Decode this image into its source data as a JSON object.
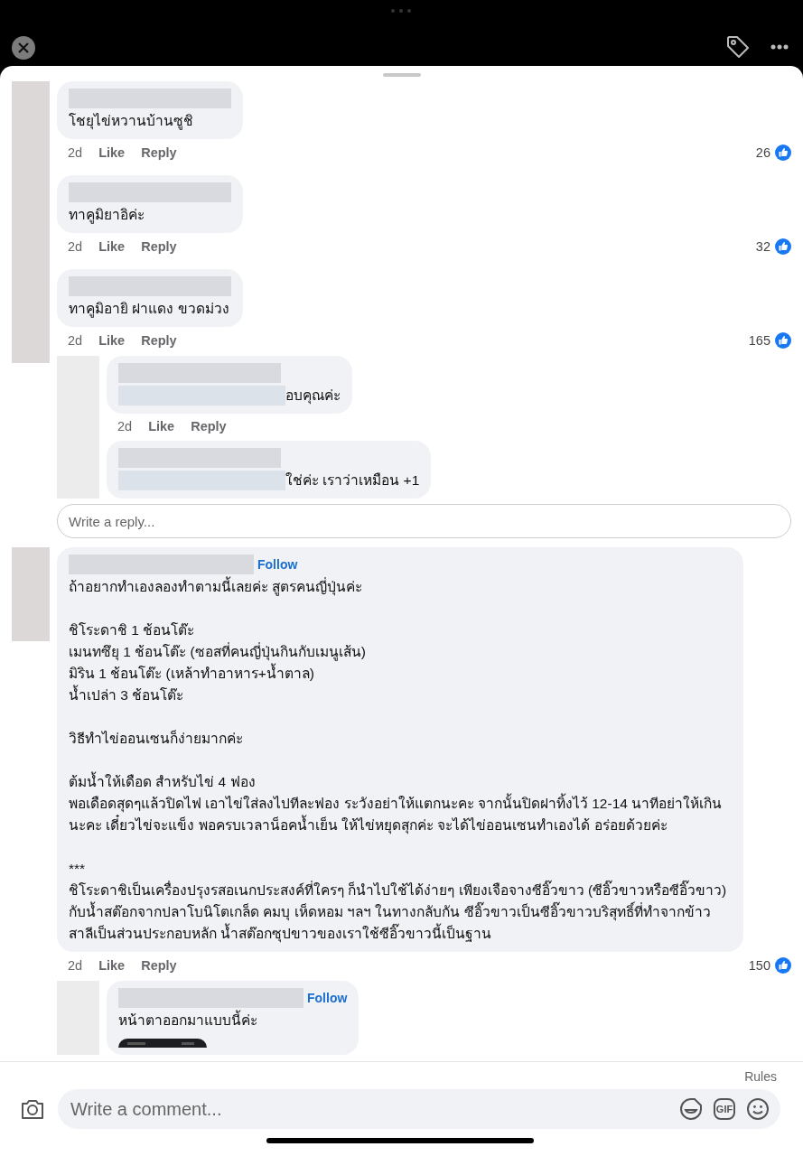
{
  "comments": [
    {
      "text": "โชยุไข่หวานบ้านซูชิ",
      "time": "2d",
      "like": "Like",
      "reply": "Reply",
      "likes": "26"
    },
    {
      "text": "ทาคูมิยาอิค่ะ",
      "time": "2d",
      "like": "Like",
      "reply": "Reply",
      "likes": "32"
    },
    {
      "text": "ทาคูมิอายิ ฝาแดง ขวดม่วง",
      "time": "2d",
      "like": "Like",
      "reply": "Reply",
      "likes": "165",
      "children": [
        {
          "text": "อบคุณค่ะ",
          "redacted_start": true,
          "time": "2d",
          "like": "Like",
          "reply": "Reply"
        },
        {
          "text": "ใช่ค่ะ เราว่าเหมือน +1",
          "redacted_start": true
        }
      ],
      "reply_placeholder": "Write a reply..."
    },
    {
      "follow": "Follow",
      "text": "ถ้าอยากทำเองลองทำตามนี้เลยค่ะ สูตรคนญี่ปุ่นค่ะ\n\nชิโระดาชิ 1 ช้อนโต๊ะ\nเมนทซึยุ 1 ช้อนโต๊ะ (ซอสที่คนญี่ปุ่นกินกับเมนูเส้น)\nมิริน 1 ช้อนโต๊ะ (เหล้าทำอาหาร+น้ำตาล)\nน้ำเปล่า 3 ช้อนโต๊ะ\n\nวิธีทำไข่ออนเซนก็ง่ายมากค่ะ\n\nต้มน้ำให้เดือด สำหรับไข่ 4 ฟอง\nพอเดือดสุดๆแล้วปิดไฟ เอาไข่ใส่ลงไปทีละฟอง ระวังอย่าให้แตกนะคะ จากนั้นปิดฝาทิ้งไว้ 12-14 นาทีอย่าให้เกินนะคะ เดี๋ยวไข่จะแข็ง พอครบเวลาน็อคน้ำเย็น ให้ไข่หยุดสุกค่ะ จะได้ไข่ออนเซนทำเองได้ อร่อยด้วยค่ะ\n\n***\nชิโระดาชิเป็นเครื่องปรุงรสอเนกประสงค์ที่ใครๆ ก็นำไปใช้ได้ง่ายๆ เพียงเจือจางซีอิ๊วขาว (ซีอิ๊วขาวหรือซีอิ๊วขาว) กับน้ำสต๊อกจากปลาโบนิโตเกล็ด คมบุ เห็ดหอม ฯลฯ ในทางกลับกัน ซีอิ๊วขาวเป็นซีอิ๊วขาวบริสุทธิ์ที่ทำจากข้าวสาลีเป็นส่วนประกอบหลัก น้ำสต๊อกซุปขาวของเราใช้ซีอิ๊วขาวนี้เป็นฐาน",
      "time": "2d",
      "like": "Like",
      "reply": "Reply",
      "likes": "150",
      "children": [
        {
          "follow": "Follow",
          "text": "หน้าตาออกมาแบบนี้ค่ะ"
        }
      ]
    }
  ],
  "composer": {
    "rules": "Rules",
    "placeholder": "Write a comment...",
    "gif": "GIF"
  }
}
